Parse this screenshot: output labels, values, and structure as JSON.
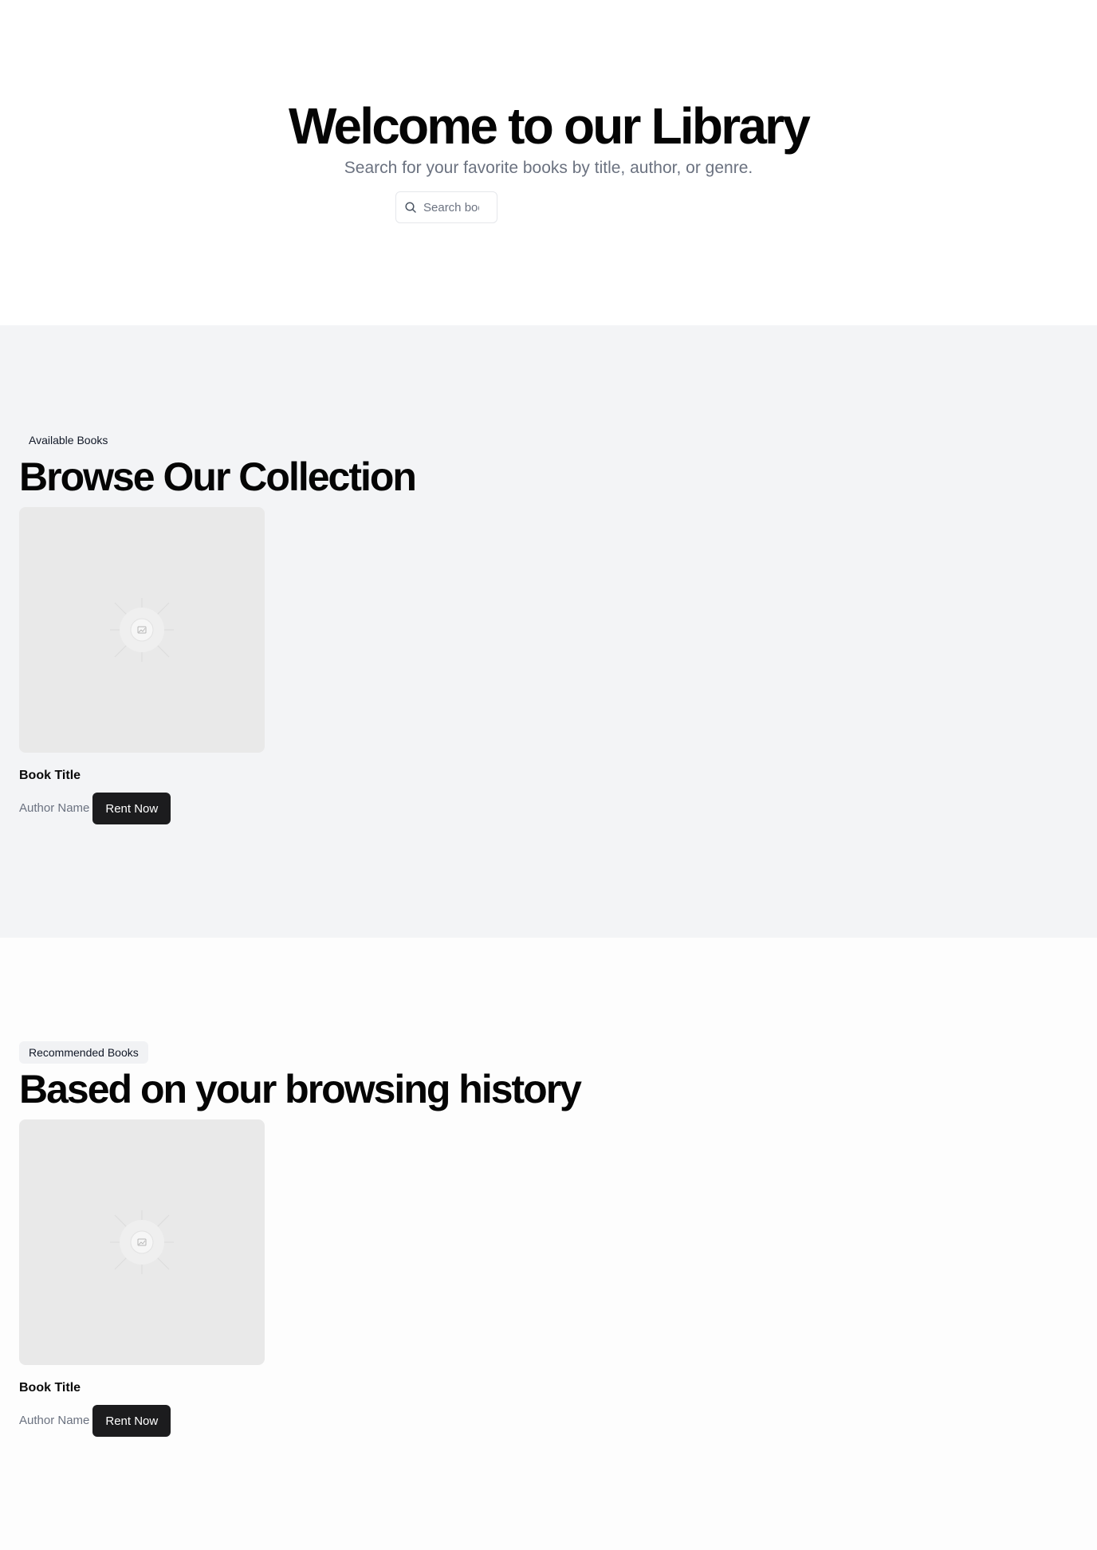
{
  "hero": {
    "title": "Welcome to our Library",
    "subtitle": "Search for your favorite books by title, author, or genre.",
    "search": {
      "placeholder": "Search books",
      "icon": "search-icon"
    }
  },
  "available": {
    "badge": "Available Books",
    "title": "Browse Our Collection",
    "books": [
      {
        "title": "Book Title",
        "author": "Author Name",
        "button": "Rent Now",
        "cover_icon": "image-placeholder-icon"
      }
    ]
  },
  "recommended": {
    "badge": "Recommended Books",
    "title": "Based on your browsing history",
    "books": [
      {
        "title": "Book Title",
        "author": "Author Name",
        "button": "Rent Now",
        "cover_icon": "image-placeholder-icon"
      }
    ]
  },
  "colors": {
    "primary_button": "#1c1c1e",
    "muted_text": "#6b7280",
    "section_bg": "#f3f4f6",
    "cover_bg": "#e9e9e9"
  }
}
